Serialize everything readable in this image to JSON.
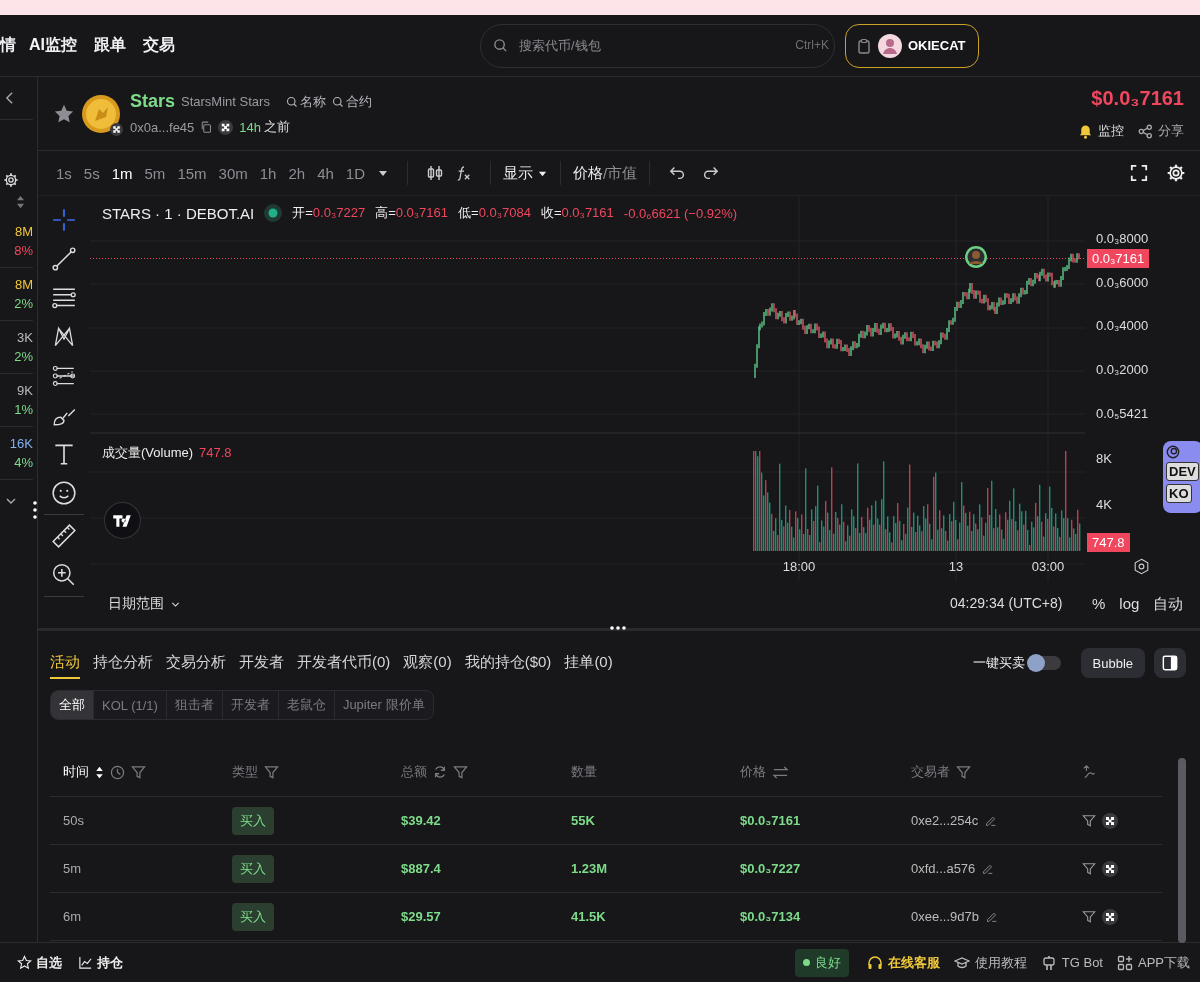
{
  "top_nav": {
    "items": [
      "情",
      "AI监控",
      "跟单",
      "交易"
    ]
  },
  "search": {
    "placeholder": "搜索代币/钱包",
    "shortcut": "Ctrl+K"
  },
  "account": {
    "name": "OKIECAT"
  },
  "sidebar": {
    "rows": [
      {
        "value": "8M",
        "change": "8%",
        "color": "#f0c93a",
        "falling": true
      },
      {
        "value": "8M",
        "change": "2%",
        "color": "#f0c93a",
        "falling": false
      },
      {
        "value": "3K",
        "change": "2%",
        "color": "#b9b9bf",
        "falling": false
      },
      {
        "value": "9K",
        "change": "1%",
        "color": "#b9b9bf",
        "falling": false
      },
      {
        "value": "16K",
        "change": "4%",
        "color": "#7fb2f0",
        "falling": false
      }
    ]
  },
  "token": {
    "symbol": "Stars",
    "name": "StarsMint Stars",
    "search_links": [
      "名称",
      "合约"
    ],
    "address": "0x0a...fe45",
    "age": "14h",
    "age_suffix": "之前",
    "price": "$0.0₃7161",
    "actions": [
      "监控",
      "分享"
    ]
  },
  "intervals": [
    {
      "label": "1s",
      "selected": false
    },
    {
      "label": "5s",
      "selected": false
    },
    {
      "label": "1m",
      "selected": true
    },
    {
      "label": "5m",
      "selected": false
    },
    {
      "label": "15m",
      "selected": false
    },
    {
      "label": "30m",
      "selected": false
    },
    {
      "label": "1h",
      "selected": false
    },
    {
      "label": "2h",
      "selected": false
    },
    {
      "label": "4h",
      "selected": false
    },
    {
      "label": "1D",
      "selected": false
    }
  ],
  "toolbar": {
    "display": "显示",
    "price_mode": [
      {
        "label": "价格",
        "selected": true
      },
      {
        "label": "市值",
        "selected": false
      }
    ],
    "mode_divider": "/"
  },
  "chart": {
    "legend_title": "STARS · 1 · DEBOT.AI",
    "ohlc": [
      {
        "label": "开=",
        "value": "0.0₃7227"
      },
      {
        "label": "高=",
        "value": "0.0₃7161"
      },
      {
        "label": "低=",
        "value": "0.0₃7084"
      },
      {
        "label": "收=",
        "value": "0.0₃7161"
      }
    ],
    "change": "-0.0₆6621 (−0.92%)",
    "price_ticks": [
      "0.0₃8000",
      "0.0₃6000",
      "0.0₃4000",
      "0.0₃2000",
      "0.0₅5421"
    ],
    "last_price": "0.0₃7161",
    "volume_label": "成交量(Volume)",
    "volume_value": "747.8",
    "volume_badge": "747.8",
    "volume_ticks": [
      "8K",
      "4K"
    ],
    "time_ticks": [
      "18:00",
      "13",
      "03:00"
    ],
    "date_range": "日期范围",
    "clock": "04:29:34 (UTC+8)",
    "scale_options": [
      "%",
      "log",
      "自动"
    ],
    "tags": [
      "DEV",
      "KO"
    ]
  },
  "panel": {
    "tabs": [
      {
        "label": "活动",
        "selected": true
      },
      {
        "label": "持仓分析",
        "selected": false
      },
      {
        "label": "交易分析",
        "selected": false
      },
      {
        "label": "开发者",
        "selected": false
      },
      {
        "label": "开发者代币(0)",
        "selected": false
      },
      {
        "label": "观察(0)",
        "selected": false
      },
      {
        "label": "我的持仓($0)",
        "selected": false
      },
      {
        "label": "挂单(0)",
        "selected": false
      }
    ],
    "quick_trade": {
      "label": "一键买卖",
      "on": false
    },
    "bubble": "Bubble",
    "filters": [
      {
        "label": "全部",
        "selected": true
      },
      {
        "label": "KOL (1/1)",
        "selected": false
      },
      {
        "label": "狙击者",
        "selected": false
      },
      {
        "label": "开发者",
        "selected": false
      },
      {
        "label": "老鼠仓",
        "selected": false
      },
      {
        "label": "Jupiter 限价单",
        "selected": false
      }
    ]
  },
  "table": {
    "columns": [
      {
        "label": "时间",
        "sorted": true
      },
      {
        "label": "类型",
        "sorted": false
      },
      {
        "label": "总额",
        "sorted": false
      },
      {
        "label": "数量",
        "sorted": false
      },
      {
        "label": "价格",
        "sorted": false
      },
      {
        "label": "交易者",
        "sorted": false
      }
    ],
    "rows": [
      {
        "time": "50s",
        "type": "买入",
        "kind": "buy",
        "total": "$39.42",
        "amount": "55K",
        "price": "$0.0₃7161",
        "trader": "0xe2...254c"
      },
      {
        "time": "5m",
        "type": "买入",
        "kind": "buy",
        "total": "$887.4",
        "amount": "1.23M",
        "price": "$0.0₃7227",
        "trader": "0xfd...a576"
      },
      {
        "time": "6m",
        "type": "买入",
        "kind": "buy",
        "total": "$29.57",
        "amount": "41.5K",
        "price": "$0.0₃7134",
        "trader": "0xee...9d7b"
      }
    ]
  },
  "footer": {
    "left": [
      "自选",
      "持仓"
    ],
    "status": "良好",
    "links": [
      "在线客服",
      "使用教程",
      "TG Bot",
      "APP下载"
    ]
  }
}
